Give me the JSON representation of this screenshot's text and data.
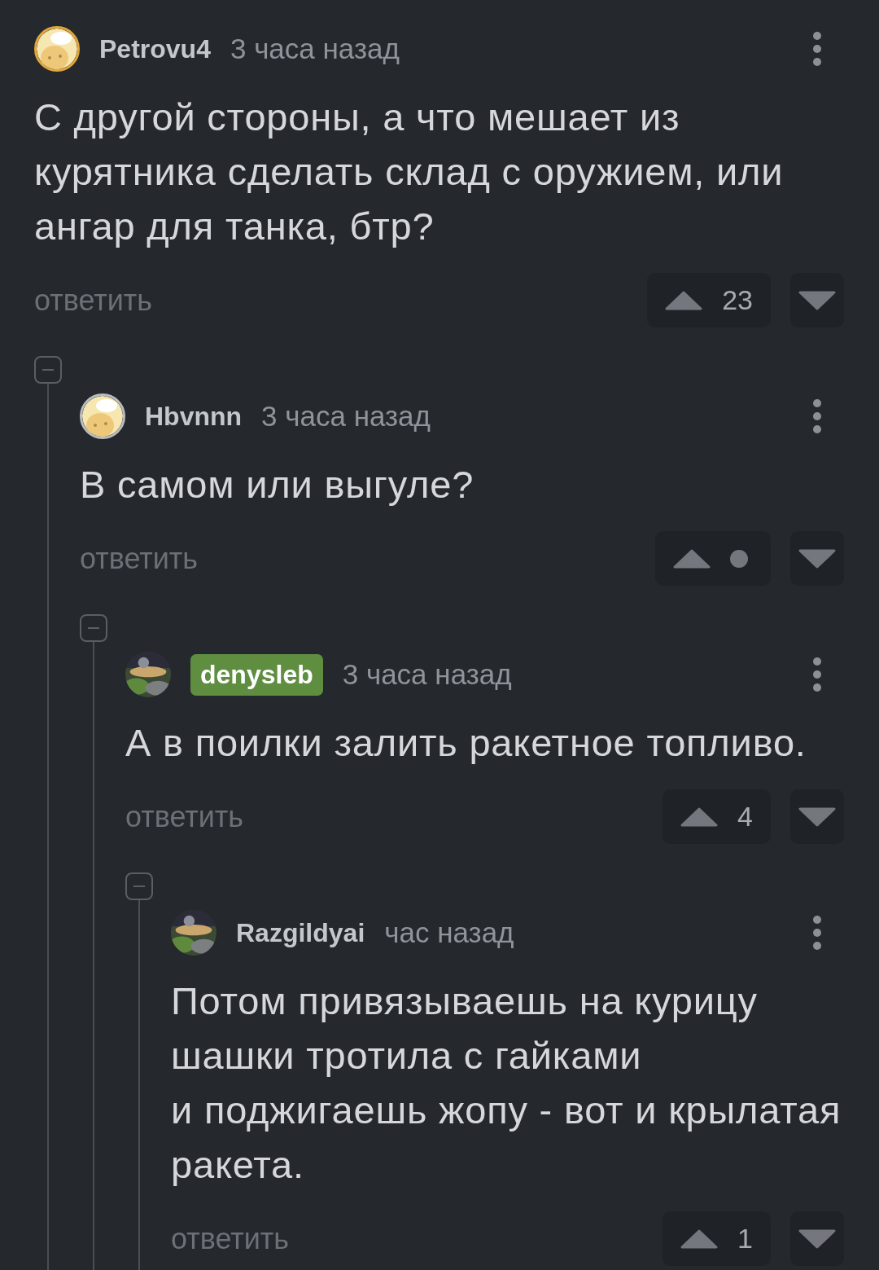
{
  "comments": [
    {
      "author": "Petrovu4",
      "author_highlighted": false,
      "time": "3 часа назад",
      "avatar": {
        "kind": "default",
        "color": "#e2a73a"
      },
      "text": "С другой стороны, а что мешает из курятника сделать склад с оружием, или ангар для танка, бтр?",
      "reply": "ответить",
      "score": "23",
      "score_hidden": false,
      "children": [
        {
          "author": "Hbvnnn",
          "author_highlighted": false,
          "time": "3 часа назад",
          "avatar": {
            "kind": "default",
            "color": "#b9bcc1"
          },
          "text": "В самом или выгуле?",
          "reply": "ответить",
          "score_hidden": true,
          "children": [
            {
              "author": "denysleb",
              "author_highlighted": true,
              "time": "3 часа назад",
              "text": "А в поилки залить ракетное топливо.",
              "reply": "ответить",
              "score": "4",
              "score_hidden": false,
              "children": [
                {
                  "author": "Razgildyai",
                  "author_highlighted": false,
                  "time": "час назад",
                  "text": "Потом привязываешь на курицу шашки тротила с гайками\nи поджигаешь жопу - вот и крылатая ракета.",
                  "reply": "ответить",
                  "score": "1",
                  "score_hidden": false
                }
              ]
            }
          ]
        }
      ]
    }
  ]
}
